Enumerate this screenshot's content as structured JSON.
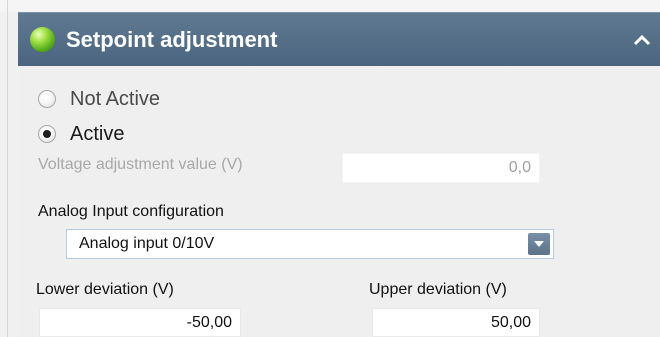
{
  "panel": {
    "title": "Setpoint adjustment",
    "status_icon": "status-ball-icon",
    "collapse_icon": "chevron-up-icon",
    "accent_color": "#54718b"
  },
  "radio_options": [
    {
      "label": "Not Active",
      "selected": false
    },
    {
      "label": "Active",
      "selected": true
    }
  ],
  "voltage_adjustment": {
    "label": "Voltage adjustment value (V)",
    "value": "0,0"
  },
  "analog_input": {
    "label": "Analog Input configuration",
    "selected": "Analog input 0/10V"
  },
  "deviation": {
    "lower_label": "Lower deviation (V)",
    "lower_value": "-50,00",
    "upper_label": "Upper deviation (V)",
    "upper_value": "50,00"
  }
}
